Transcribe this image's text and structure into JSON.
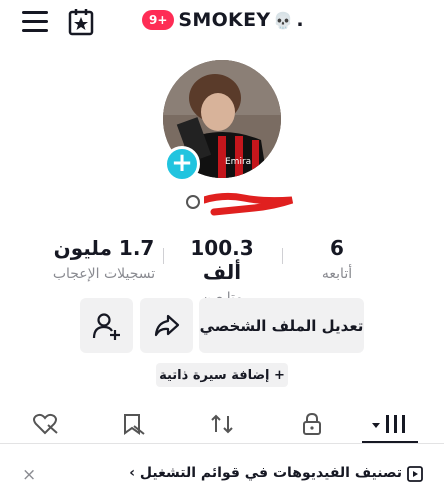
{
  "header": {
    "badge": "9+",
    "username": "SMOKEY",
    "skull": "💀",
    "dot": ".",
    "menu_icon": "hamburger-icon",
    "calendar_icon": "calendar-star-icon"
  },
  "avatar": {
    "add_symbol": "+"
  },
  "stats": [
    {
      "value": "6",
      "label": "أتابعه"
    },
    {
      "value": "100.3 ألف",
      "label": "متابعين"
    },
    {
      "value": "1.7 مليون",
      "label": "تسجيلات الإعجاب"
    }
  ],
  "buttons": {
    "edit_profile": "تعديل الملف الشخصي",
    "share_icon": "share-icon",
    "add_user_icon": "add-user-icon"
  },
  "bio_button": "+ إضافة سيرة ذاتية",
  "tabs": [
    "videos-grid-icon",
    "lock-icon",
    "repost-icon",
    "saved-icon",
    "liked-icon"
  ],
  "banner": {
    "text": "تصنيف الفيديوهات في قوائم التشغيل ›",
    "close": "×"
  },
  "colors": {
    "accent_red": "#fe2c55",
    "avatar_add": "#21c4df",
    "text": "#161823",
    "muted": "#8a8b91"
  }
}
